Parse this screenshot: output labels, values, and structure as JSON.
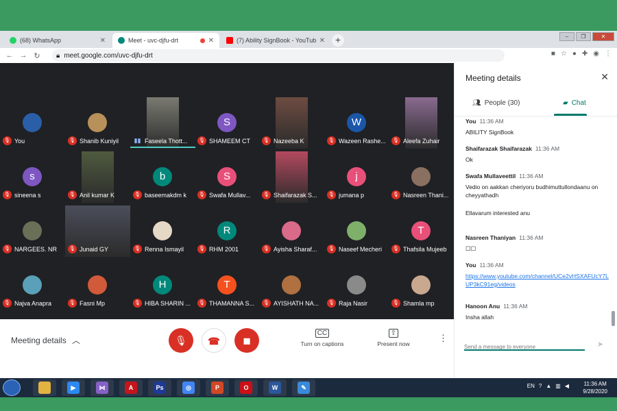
{
  "browser": {
    "tabs": [
      {
        "label": "(68) WhatsApp",
        "color": "#25d366",
        "active": false
      },
      {
        "label": "Meet - uvc-djfu-drt",
        "color": "#00897b",
        "active": true
      },
      {
        "label": "(7) Ability SignBook - YouTube",
        "color": "#ff0000",
        "active": false
      }
    ],
    "url": "meet.google.com/uvc-djfu-drt"
  },
  "participants": [
    {
      "name": "You",
      "type": "avatar",
      "letter": "",
      "color": "#2a5fa8"
    },
    {
      "name": "Shanib Kuniyil",
      "type": "avatar",
      "letter": "",
      "color": "#b8905a"
    },
    {
      "name": "Faseela Thott...",
      "type": "video",
      "letter": "",
      "color": "#7a7a72",
      "speaking": true
    },
    {
      "name": "SHAMEEM CT",
      "type": "avatar",
      "letter": "S",
      "color": "#7e57c2"
    },
    {
      "name": "Nazeeba K",
      "type": "video",
      "letter": "",
      "color": "#6d4c41"
    },
    {
      "name": "Wazeen Rashe...",
      "type": "avatar",
      "letter": "W",
      "color": "#1a57a8"
    },
    {
      "name": "Aleefa Zuhair",
      "type": "video",
      "letter": "",
      "color": "#8a6a90"
    },
    {
      "name": "sineena s",
      "type": "avatar",
      "letter": "s",
      "color": "#7e57c2"
    },
    {
      "name": "Anil kumar K",
      "type": "video",
      "letter": "",
      "color": "#4f5b3f"
    },
    {
      "name": "baseemakdm k",
      "type": "avatar",
      "letter": "b",
      "color": "#00897b"
    },
    {
      "name": "Swafa Mullav...",
      "type": "avatar",
      "letter": "S",
      "color": "#e8507a"
    },
    {
      "name": "Shaifarazak S...",
      "type": "video",
      "letter": "",
      "color": "#b3495e"
    },
    {
      "name": "jumana p",
      "type": "avatar",
      "letter": "j",
      "color": "#e8507a"
    },
    {
      "name": "Nasreen Thani...",
      "type": "avatar",
      "letter": "",
      "color": "#8a7060"
    },
    {
      "name": "NARGEES. NR",
      "type": "avatar",
      "letter": "",
      "color": "#6a6f58"
    },
    {
      "name": "Junaid GY",
      "type": "video",
      "letter": "",
      "color": "#4b4e5a",
      "wide": true
    },
    {
      "name": "Renna Ismayil",
      "type": "avatar",
      "letter": "",
      "color": "#e6d8c6"
    },
    {
      "name": "RHM 2001",
      "type": "avatar",
      "letter": "R",
      "color": "#00897b"
    },
    {
      "name": "Ayisha Sharaf...",
      "type": "avatar",
      "letter": "",
      "color": "#d96a8a"
    },
    {
      "name": "Naseef Mecheri",
      "type": "avatar",
      "letter": "",
      "color": "#7fb06a"
    },
    {
      "name": "Thafsila Mujeeb",
      "type": "avatar",
      "letter": "T",
      "color": "#e8507a"
    },
    {
      "name": "Najva Anapra",
      "type": "avatar",
      "letter": "",
      "color": "#5aa0b8"
    },
    {
      "name": "Fasni Mp",
      "type": "avatar",
      "letter": "",
      "color": "#d05a3a"
    },
    {
      "name": "HIBA SHARIN ...",
      "type": "avatar",
      "letter": "H",
      "color": "#00897b"
    },
    {
      "name": "THAMANNA S...",
      "type": "avatar",
      "letter": "T",
      "color": "#f4511e"
    },
    {
      "name": "AYISHATH NA...",
      "type": "avatar",
      "letter": "",
      "color": "#b07040"
    },
    {
      "name": "Raja Nasir",
      "type": "avatar",
      "letter": "",
      "color": "#8a8a8a"
    },
    {
      "name": "Shamla mp",
      "type": "avatar",
      "letter": "",
      "color": "#c9a890"
    }
  ],
  "controls": {
    "meeting_details": "Meeting details",
    "captions": "Turn on captions",
    "captions_icon": "CC",
    "present": "Present now",
    "present_icon": "⇧"
  },
  "panel": {
    "title": "Meeting details",
    "people_tab": "People (30)",
    "chat_tab": "Chat",
    "messages": [
      {
        "sender": "You",
        "time": "11:36 AM",
        "text": "ABILITY SignBook",
        "link": false
      },
      {
        "sender": "Shaifarazak Shaifarazak",
        "time": "11:36 AM",
        "text": "Ok",
        "link": false
      },
      {
        "sender": "Swafa Mullaveettil",
        "time": "11:36 AM",
        "text": "Vedio on aakkan cheriyoru budhimuttullondaanu on cheyyathadh",
        "text2": "Ellavarum interested anu",
        "link": false
      },
      {
        "sender": "Nasreen Thaniyan",
        "time": "11:36 AM",
        "text": "☐☐",
        "link": false
      },
      {
        "sender": "You",
        "time": "11:36 AM",
        "text": "https://www.youtube.com/channel/UCe2vHSXAFUcY7LUP3kC91eg/videos",
        "link": true
      },
      {
        "sender": "Hanoon Anu",
        "time": "11:36 AM",
        "text": "Insha allah",
        "link": false
      }
    ],
    "input_placeholder": "Send a message to everyone"
  },
  "taskbar": {
    "lang": "EN",
    "time": "11:36 AM",
    "date": "9/28/2020",
    "apps": [
      {
        "name": "explorer",
        "color": "#e3b341",
        "glyph": ""
      },
      {
        "name": "media-player",
        "color": "#2d89ef",
        "glyph": "▶"
      },
      {
        "name": "visual-studio",
        "color": "#8661c5",
        "glyph": "⋈"
      },
      {
        "name": "acrobat",
        "color": "#c4161c",
        "glyph": "A"
      },
      {
        "name": "photoshop",
        "color": "#1f3a93",
        "glyph": "Ps"
      },
      {
        "name": "chrome",
        "color": "#4285f4",
        "glyph": "◎"
      },
      {
        "name": "powerpoint",
        "color": "#d24726",
        "glyph": "P"
      },
      {
        "name": "opera",
        "color": "#cc0f16",
        "glyph": "O"
      },
      {
        "name": "word",
        "color": "#2b579a",
        "glyph": "W"
      },
      {
        "name": "paint",
        "color": "#3b8ad9",
        "glyph": "✎"
      }
    ]
  }
}
